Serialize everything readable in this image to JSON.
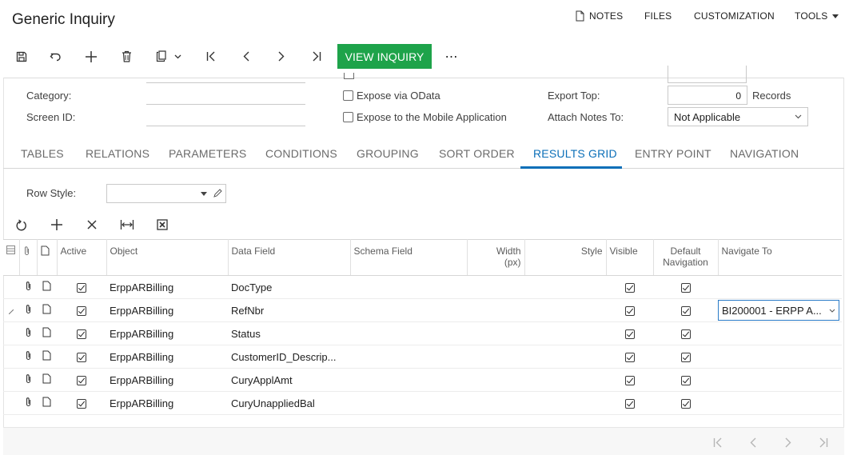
{
  "page_title": "Generic Inquiry",
  "topnav": {
    "notes": "NOTES",
    "files": "FILES",
    "customization": "CUSTOMIZATION",
    "tools": "TOOLS"
  },
  "toolbar": {
    "view_inquiry": "VIEW INQUIRY",
    "more": "⋯"
  },
  "form": {
    "category_label": "Category:",
    "screen_id_label": "Screen ID:",
    "expose_odata": "Expose via OData",
    "expose_mobile": "Expose to the Mobile Application",
    "export_top_label": "Export Top:",
    "export_top_value": "0",
    "records_label": "Records",
    "attach_notes_label": "Attach Notes To:",
    "attach_notes_value": "Not Applicable"
  },
  "tabs": [
    "TABLES",
    "RELATIONS",
    "PARAMETERS",
    "CONDITIONS",
    "GROUPING",
    "SORT ORDER",
    "RESULTS GRID",
    "ENTRY POINT",
    "NAVIGATION"
  ],
  "active_tab": "RESULTS GRID",
  "row_style_label": "Row Style:",
  "grid": {
    "headers": {
      "active": "Active",
      "object": "Object",
      "data_field": "Data Field",
      "schema_field": "Schema Field",
      "width_line1": "Width",
      "width_line2": "(px)",
      "style": "Style",
      "visible": "Visible",
      "default_nav_line1": "Default",
      "default_nav_line2": "Navigation",
      "navigate_to": "Navigate To"
    },
    "rows": [
      {
        "object": "ErppARBilling",
        "data_field": "DocType"
      },
      {
        "object": "ErppARBilling",
        "data_field": "RefNbr",
        "navigate_to": "BI200001 - ERPP A..."
      },
      {
        "object": "ErppARBilling",
        "data_field": "Status"
      },
      {
        "object": "ErppARBilling",
        "data_field": "CustomerID_Descrip..."
      },
      {
        "object": "ErppARBilling",
        "data_field": "CuryApplAmt"
      },
      {
        "object": "ErppARBilling",
        "data_field": "CuryUnappliedBal"
      }
    ]
  },
  "colors": {
    "accent": "#0b6fb8",
    "primary_button": "#1ea34a"
  }
}
